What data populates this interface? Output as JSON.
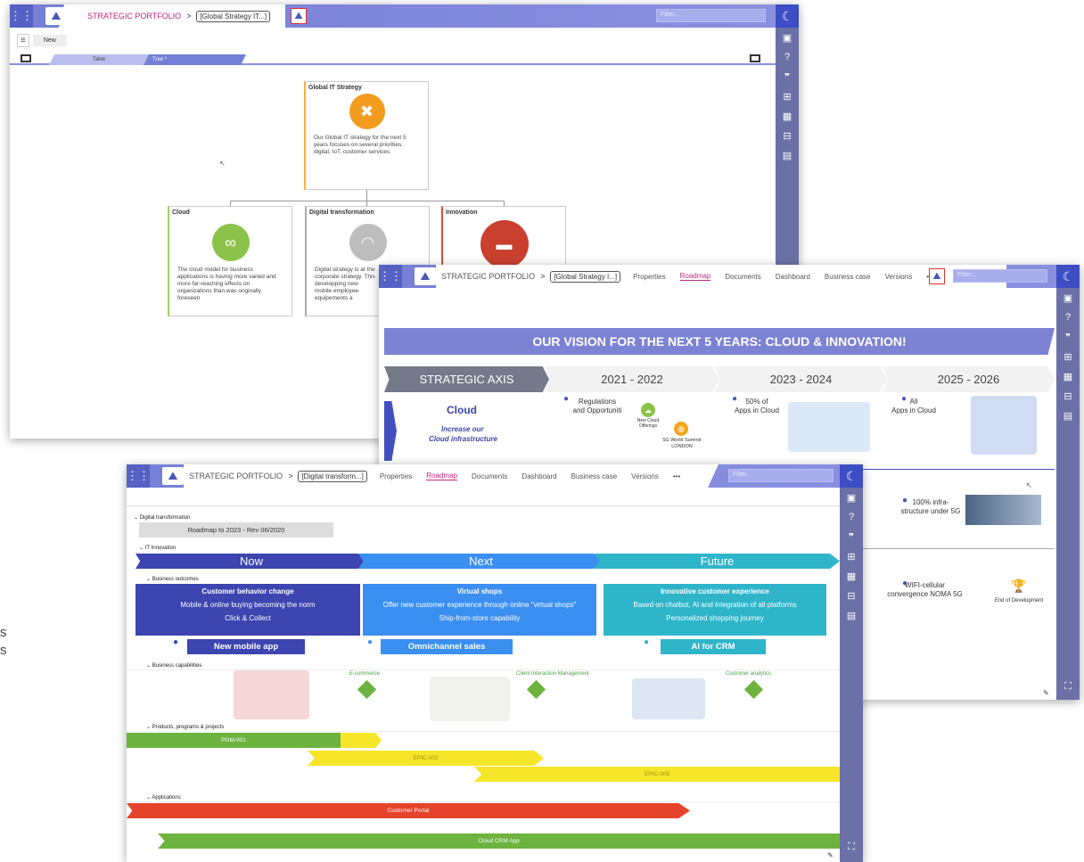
{
  "colors": {
    "accent": "#7480d6",
    "rail": "#6b70a6",
    "pink": "#c0267d",
    "now": "#3d45b0",
    "next": "#3a8ff0",
    "future": "#2fb5c9",
    "green": "#6db33f",
    "yellow": "#f5e62a",
    "red": "#e6432c"
  },
  "left_text": {
    "line1": "s",
    "line2": "s"
  },
  "win1": {
    "crumb": "STRATEGIC PORTFOLIO",
    "chevron": ">",
    "select": "[Global Strategy IT...]",
    "filter": "Filter...",
    "new_label": "New",
    "tabs": [
      "Table",
      "Tree *"
    ],
    "tree_root": {
      "title": "Global IT Strategy",
      "desc": "Our Global IT strategy for the next 5 years focuses on several priorities: digital, IoT, customer services",
      "icon": "network-icon"
    },
    "children": [
      {
        "title": "Cloud",
        "desc": "The cloud model for business applications is having more varied and more far-reaching effects on organizations than was originally foreseen",
        "icon": "cloud-link-icon"
      },
      {
        "title": "Digital transformation",
        "desc": "Digital strategy is at the corporate strategy. This developping new mobile employee equipements a",
        "icon": "wifi-icon"
      },
      {
        "title": "Innovation",
        "desc": "",
        "icon": "folder-icon"
      }
    ]
  },
  "win2": {
    "crumb": "STRATEGIC PORTFOLIO",
    "select": "[Global Strategy I...]",
    "tabs": [
      "Properties",
      "Roadmap",
      "Documents",
      "Dashboard",
      "Business case",
      "Versions",
      "•••"
    ],
    "filter": "Filter...",
    "banner": "OUR VISION FOR THE NEXT 5 YEARS: CLOUD & INNOVATION!",
    "axis": [
      "STRATEGIC AXIS",
      "2021 - 2022",
      "2023 - 2024",
      "2025 - 2026"
    ],
    "row_title": "Cloud",
    "row_sub1": "Increase our",
    "row_sub2": "Cloud infrastructure",
    "milestones": [
      {
        "l1": "Regulations",
        "l2": "and Opportuniti"
      },
      {
        "l1": "New Cloud",
        "l2": "Offerings"
      },
      {
        "l1": "5G World Summit",
        "l2": "LONDON"
      },
      {
        "l1": "50% of",
        "l2": "Apps in Cloud"
      },
      {
        "l1": "All",
        "l2": "Apps in Cloud"
      },
      {
        "l1": "100% infra-",
        "l2": "structure under 5G"
      },
      {
        "l1": "WIFI-cellular",
        "l2": "convergence NOMA 5G"
      },
      {
        "l1": "End of Development",
        "l2": ""
      }
    ]
  },
  "win3": {
    "crumb": "STRATEGIC PORTFOLIO",
    "select": "[Digital transform...]",
    "tabs": [
      "Properties",
      "Roadmap",
      "Documents",
      "Dashboard",
      "Business case",
      "Versions",
      "•••"
    ],
    "filter": "Filter...",
    "section": "Digital transformation",
    "roadmap_label": "Roadmap to 2023 - Rev 06/2020",
    "lanes": {
      "it": "IT Innovation",
      "outcomes": "Business outcomes",
      "caps": "Business capabilities",
      "products": "Products, programs & projects",
      "apps": "Applications"
    },
    "phases": [
      "Now",
      "Next",
      "Future"
    ],
    "outcomes": [
      {
        "title": "Customer behavior change",
        "l1": "Mobile & online buying becoming the norm",
        "l2": "Click & Collect",
        "tag": "New mobile app"
      },
      {
        "title": "Virtual shops",
        "l1": "Offer new customer experience through online \"virtual shops\"",
        "l2": "Ship-from-store capability",
        "tag": "Omnichannel sales"
      },
      {
        "title": "Innovative customer experience",
        "l1": "Based on chatbot, AI and integration of all platforms",
        "l2": "Personalized shopping journey",
        "tag": "AI for CRM"
      }
    ],
    "capabilities": [
      "E-commerce",
      "Client Interaction Management",
      "Customer analytics"
    ],
    "projects": [
      "PGM-001",
      "EPIC-002",
      "EPIC-005"
    ],
    "applications": [
      "Customer Portal",
      "Cloud CRM App"
    ]
  }
}
